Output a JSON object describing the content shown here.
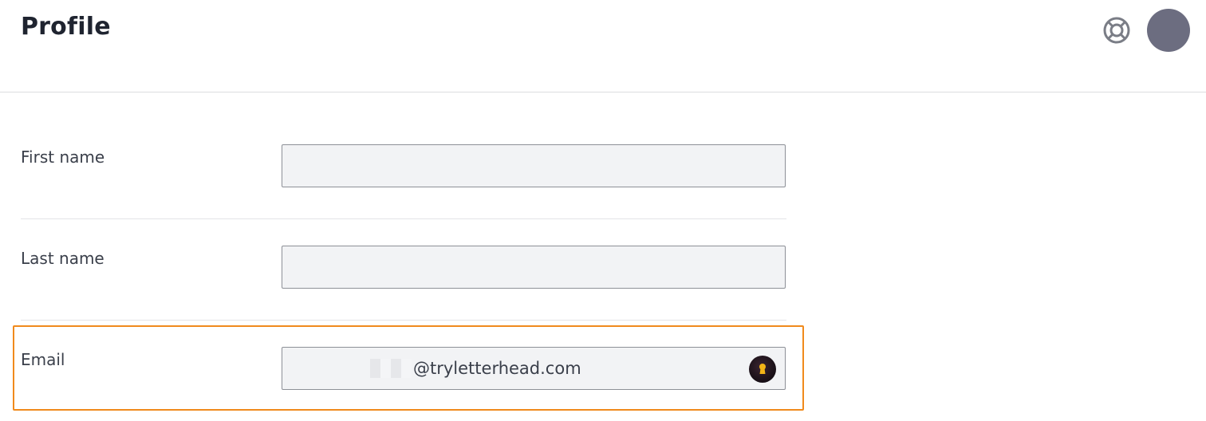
{
  "header": {
    "title": "Profile",
    "help_icon": "lifebuoy-icon",
    "avatar_color": "#6c6d80"
  },
  "form": {
    "first_name": {
      "label": "First name",
      "value": ""
    },
    "last_name": {
      "label": "Last name",
      "value": ""
    },
    "email": {
      "label": "Email",
      "value_suffix": "@tryletterhead.com",
      "redacted": true,
      "password_manager_icon": "keyhole-icon"
    }
  },
  "highlight_color": "#f08a1c"
}
